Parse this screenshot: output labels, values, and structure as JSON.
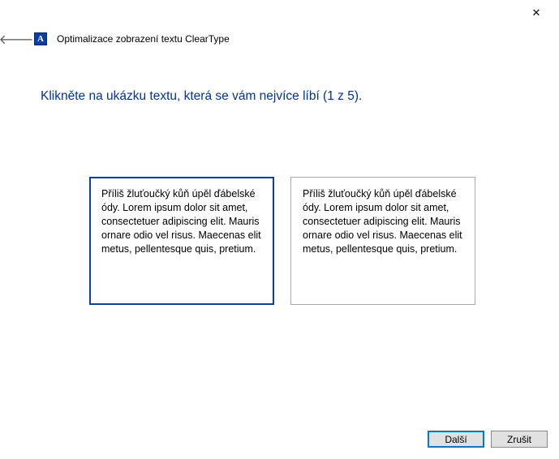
{
  "window": {
    "title": "Optimalizace zobrazení textu ClearType",
    "icon_letter": "A"
  },
  "heading": "Klikněte na ukázku textu, která se vám nejvíce líbí (1 z 5).",
  "samples": [
    {
      "text": "Příliš žluťoučký kůň úpěl ďábelské ódy. Lorem ipsum dolor sit amet, consectetuer adipiscing elit. Mauris ornare odio vel risus. Maecenas elit metus, pellentesque quis, pretium.",
      "selected": true
    },
    {
      "text": "Příliš žluťoučký kůň úpěl ďábelské ódy. Lorem ipsum dolor sit amet, consectetuer adipiscing elit. Mauris ornare odio vel risus. Maecenas elit metus, pellentesque quis, pretium.",
      "selected": false
    }
  ],
  "buttons": {
    "next": "Další",
    "cancel": "Zrušit"
  }
}
